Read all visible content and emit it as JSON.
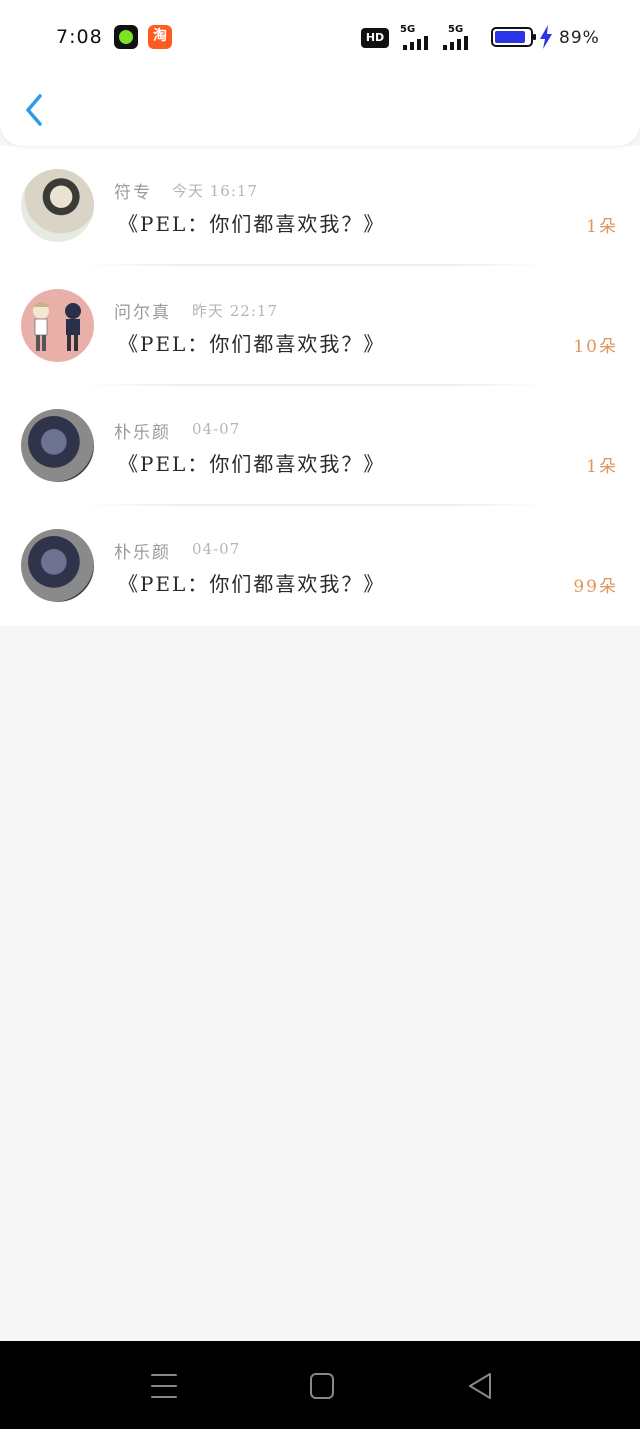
{
  "status_bar": {
    "time": "7:08",
    "app_icon_2_glyph": "淘",
    "hd_label": "HD",
    "network_1": "5G",
    "network_2": "5G",
    "battery_percent": "89%",
    "battery_level": 0.89,
    "battery_color": "#2b35e6"
  },
  "nav": {
    "back_icon": "chevron-left-icon",
    "accent": "#2d9be8"
  },
  "items": [
    {
      "name": "符专",
      "time": "今天 16:17",
      "message": "《PEL：你们都喜欢我？》",
      "count": "1朵"
    },
    {
      "name": "问尔真",
      "time": "昨天 22:17",
      "message": "《PEL：你们都喜欢我？》",
      "count": "10朵"
    },
    {
      "name": "朴乐颜",
      "time": "04-07",
      "message": "《PEL：你们都喜欢我？》",
      "count": "1朵"
    },
    {
      "name": "朴乐颜",
      "time": "04-07",
      "message": "《PEL：你们都喜欢我？》",
      "count": "99朵"
    }
  ],
  "colors": {
    "count": "#e0955a",
    "name": "#9a9a9a",
    "page_bg": "#f7f6f7"
  },
  "system_nav": {
    "menu_icon": "menu-icon",
    "home_icon": "home-square-icon",
    "back_icon": "back-triangle-icon"
  }
}
